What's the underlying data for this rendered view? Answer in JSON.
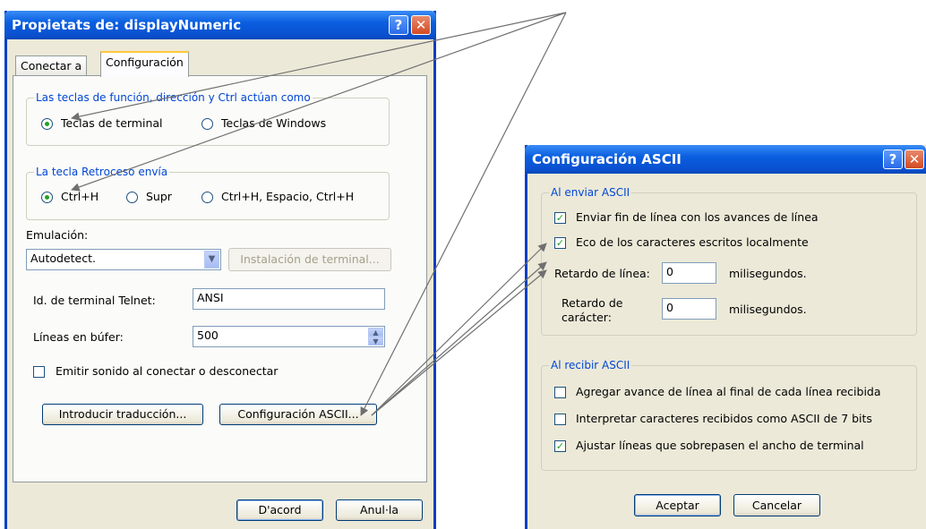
{
  "left_window": {
    "title": "Propietats de: displayNumeric",
    "help_glyph": "?",
    "close_glyph": "✕",
    "tabs": [
      {
        "label": "Conectar a"
      },
      {
        "label": "Configuración"
      }
    ],
    "group_keys": {
      "label": "Las teclas de función, dirección y Ctrl actúan como",
      "options": [
        {
          "label": "Teclas de terminal",
          "selected": true
        },
        {
          "label": "Teclas de Windows",
          "selected": false
        }
      ]
    },
    "group_backspace": {
      "label": "La tecla Retroceso envía",
      "options": [
        {
          "label": "Ctrl+H",
          "selected": true
        },
        {
          "label": "Supr",
          "selected": false
        },
        {
          "label": "Ctrl+H, Espacio, Ctrl+H",
          "selected": false
        }
      ]
    },
    "emulation_label": "Emulación:",
    "emulation_value": "Autodetect.",
    "terminal_setup_button": "Instalación de terminal...",
    "telnet_id_label": "Id. de terminal Telnet:",
    "telnet_id_value": "ANSI",
    "buffer_lines_label": "Líneas en búfer:",
    "buffer_lines_value": "500",
    "beep_label": "Emitir sonido al conectar o desconectar",
    "beep_checked": false,
    "translation_button": "Introducir traducción...",
    "ascii_button": "Configuración ASCII...",
    "ok_button": "D'acord",
    "cancel_button": "Anul·la"
  },
  "right_window": {
    "title": "Configuración ASCII",
    "help_glyph": "?",
    "close_glyph": "✕",
    "send_group": {
      "label": "Al enviar ASCII",
      "checks": [
        {
          "label": "Enviar fin de línea con los avances de línea",
          "checked": true
        },
        {
          "label": "Eco de los caracteres escritos localmente",
          "checked": true
        }
      ],
      "line_delay_label": "Retardo de línea:",
      "line_delay_value": "0",
      "line_delay_unit": "milisegundos.",
      "char_delay_label_1": "Retardo de",
      "char_delay_label_2": "carácter:",
      "char_delay_value": "0",
      "char_delay_unit": "milisegundos."
    },
    "receive_group": {
      "label": "Al recibir ASCII",
      "checks": [
        {
          "label": "Agregar avance de línea al final de cada línea recibida",
          "checked": false
        },
        {
          "label": "Interpretar caracteres recibidos como ASCII de 7 bits",
          "checked": false
        },
        {
          "label": "Ajustar líneas que sobrepasen el ancho de terminal",
          "checked": true
        }
      ]
    },
    "ok_button": "Aceptar",
    "cancel_button": "Cancelar"
  },
  "colors": {
    "titlebar": "#0a5fe0",
    "group_label": "#0046d5",
    "annotation_lines": "#707070"
  }
}
